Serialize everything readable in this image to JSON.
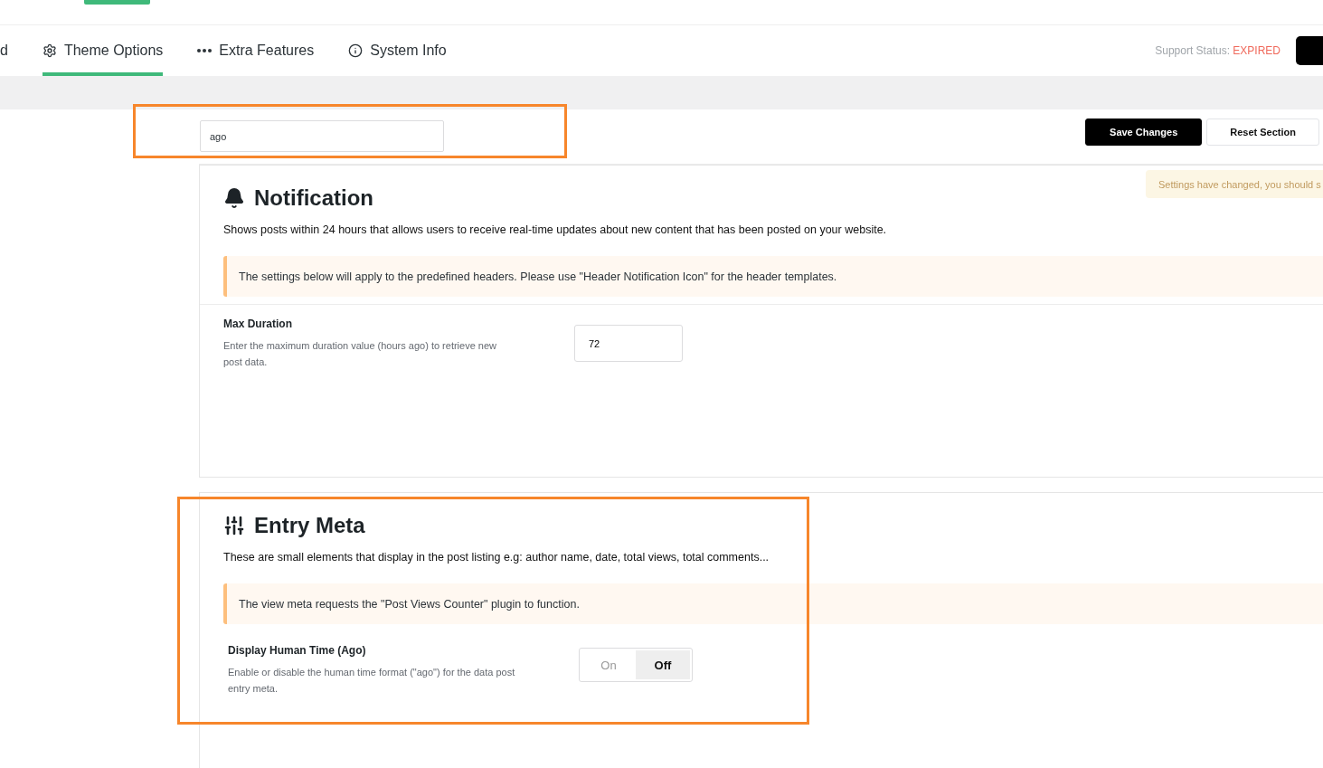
{
  "tabs": [
    {
      "label": "d",
      "kind": "plain",
      "selected": false
    },
    {
      "label": "Theme Options",
      "kind": "gear",
      "selected": true
    },
    {
      "label": "Extra Features",
      "kind": "dots",
      "selected": false
    },
    {
      "label": "System Info",
      "kind": "info",
      "selected": false
    }
  ],
  "support_status": {
    "label": "Support Status:",
    "value": "EXPIRED"
  },
  "search": {
    "value": "ago",
    "highlighted": true
  },
  "buttons": [
    {
      "label": "Save Changes",
      "kind": "primary"
    },
    {
      "label": "Reset Section",
      "kind": "secondary"
    }
  ],
  "notice": "Settings have changed, you should s",
  "sections": [
    {
      "kind": "bell",
      "title": "Notification",
      "highlighted": false,
      "description": "Shows posts within 24 hours that allows users to receive real-time updates about new content that has been posted on your website.",
      "note": "The settings below will apply to the predefined headers. Please use \"Header Notification Icon\" for the header templates.",
      "fields": [
        {
          "kind": "text",
          "label": "Max Duration",
          "help": "Enter the maximum duration value (hours ago) to retrieve new post data.",
          "value": "72"
        }
      ]
    },
    {
      "kind": "sliders",
      "title": "Entry Meta",
      "highlighted": true,
      "description": "These are small elements that display in the post listing e.g: author name, date, total views, total comments...",
      "note": "The view meta requests the \"Post Views Counter\" plugin to function.",
      "fields": [
        {
          "kind": "toggle",
          "label": "Display Human Time (Ago)",
          "help": "Enable or disable the human time format (\"ago\") for the data post entry meta.",
          "options": [
            {
              "label": "On",
              "selected": false
            },
            {
              "label": "Off",
              "selected": true
            }
          ]
        }
      ]
    }
  ]
}
